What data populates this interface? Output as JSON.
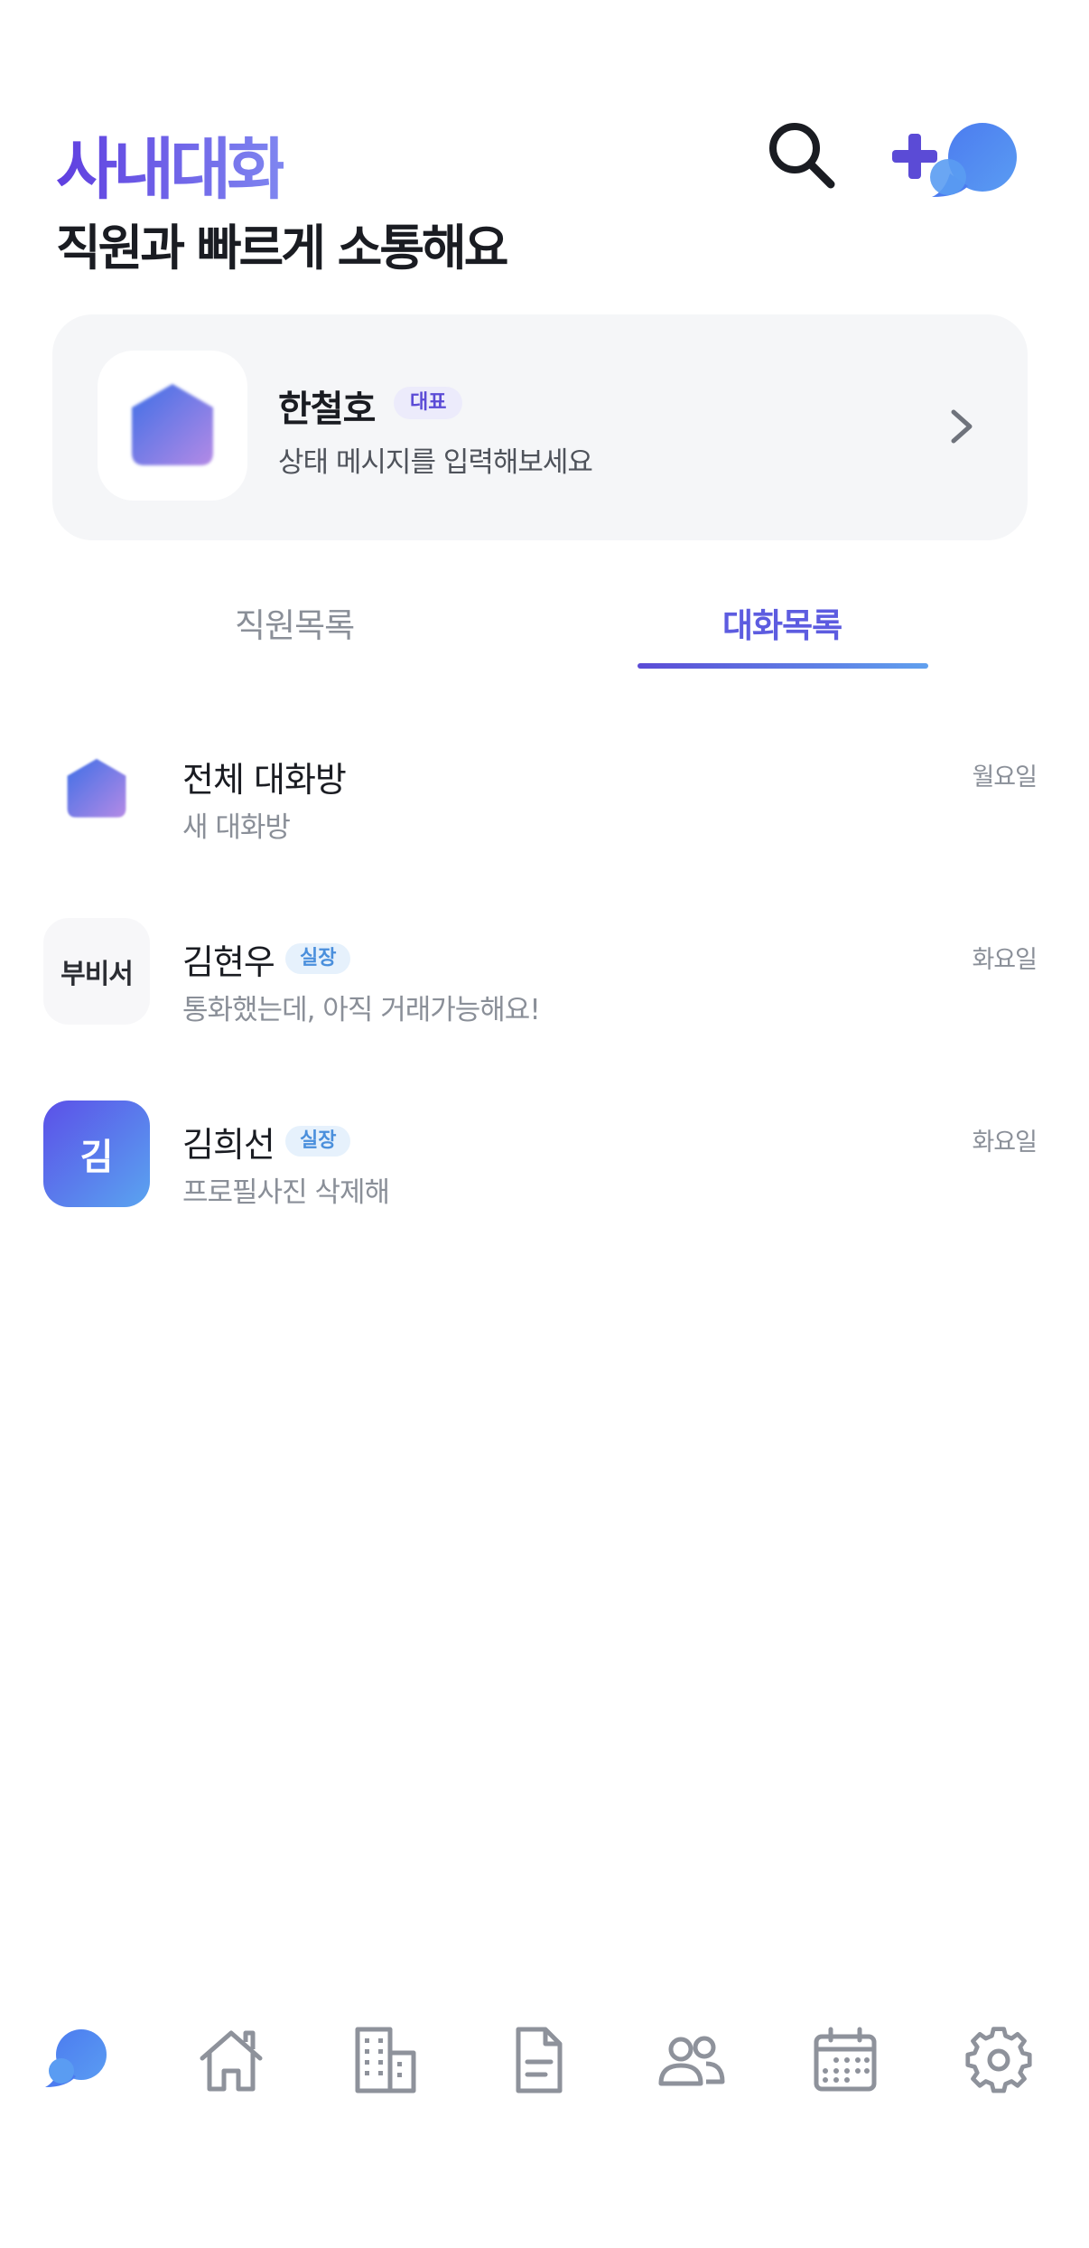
{
  "header": {
    "title": "사내대화",
    "subtitle": "직원과 빠르게 소통해요",
    "search_icon": "search-icon",
    "new_chat_icon": "new-chat-icon"
  },
  "profile": {
    "name": "한철호",
    "badge": "대표",
    "status_placeholder": "상태 메시지를 입력해보세요"
  },
  "tabs": [
    {
      "label": "직원목록",
      "active": false
    },
    {
      "label": "대화목록",
      "active": true
    }
  ],
  "chats": [
    {
      "name": "전체 대화방",
      "badge": "",
      "preview": "새 대화방",
      "time": "월요일",
      "avatar": ""
    },
    {
      "name": "김현우",
      "badge": "실장",
      "preview": "통화했는데, 아직 거래가능해요!",
      "time": "화요일",
      "avatar": "부비서"
    },
    {
      "name": "김희선",
      "badge": "실장",
      "preview": "프로필사진 삭제해",
      "time": "화요일",
      "avatar": "김"
    }
  ],
  "bottom_nav": [
    {
      "icon": "chat-icon",
      "active": true
    },
    {
      "icon": "home-icon",
      "active": false
    },
    {
      "icon": "building-icon",
      "active": false
    },
    {
      "icon": "document-icon",
      "active": false
    },
    {
      "icon": "people-icon",
      "active": false
    },
    {
      "icon": "calendar-icon",
      "active": false
    },
    {
      "icon": "settings-icon",
      "active": false
    }
  ],
  "colors": {
    "accent": "#5d5ce0",
    "accent_gradient_end": "#60a0ee",
    "text_primary": "#1a1c22",
    "text_secondary": "#8a8f98",
    "nav_inactive": "#8e929b",
    "card_bg": "#f5f6f8"
  }
}
